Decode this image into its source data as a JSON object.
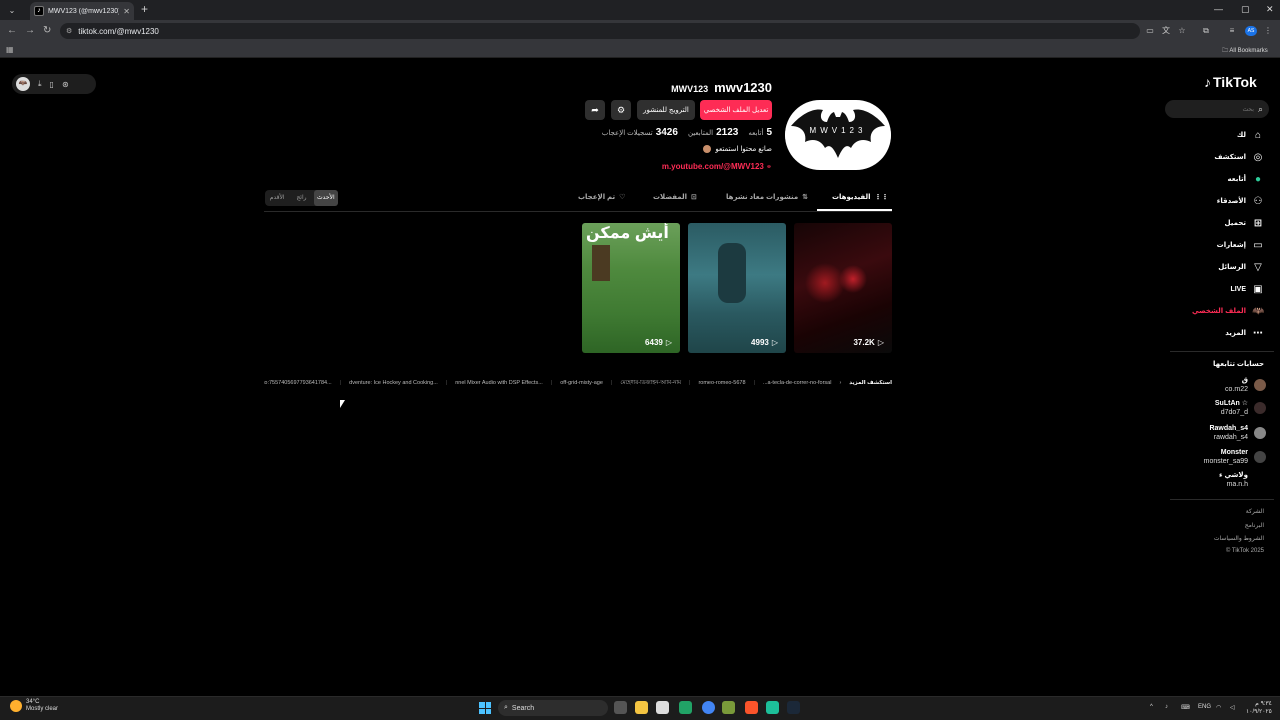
{
  "browser": {
    "tab_title": "MWV123 (@mwv1230) | TikTok",
    "new_tab": "+",
    "url": "tiktok.com/@mwv1230",
    "all_bookmarks": "All Bookmarks",
    "profile_initials": "AS"
  },
  "extension_pill": {
    "icons": [
      "bat-icon",
      "download-icon",
      "phone-icon",
      "settings-icon"
    ]
  },
  "sidebar": {
    "logo": "TikTok",
    "search_placeholder": "بحث",
    "nav": [
      {
        "label": "لك",
        "icon": "home-icon"
      },
      {
        "label": "استكشف",
        "icon": "compass-icon"
      },
      {
        "label": "أتابعه",
        "icon": "following-icon"
      },
      {
        "label": "الأصدقاء",
        "icon": "friends-icon"
      },
      {
        "label": "تحميل",
        "icon": "upload-icon"
      },
      {
        "label": "إشعارات",
        "icon": "notifications-icon"
      },
      {
        "label": "الرسائل",
        "icon": "messages-icon"
      },
      {
        "label": "LIVE",
        "icon": "live-icon"
      },
      {
        "label": "الملف الشخصي",
        "icon": "profile-icon",
        "active": true
      },
      {
        "label": "المزيد",
        "icon": "more-icon"
      }
    ],
    "following_heading": "حسابات تتابعها",
    "following": [
      {
        "name": "ق",
        "handle": "co.m22"
      },
      {
        "name": "SuLtAn ☆",
        "handle": "d7do7_d"
      },
      {
        "name": "Rawdah_s4",
        "handle": "rawdah_s4"
      },
      {
        "name": "Monster",
        "handle": "monster_sa99"
      },
      {
        "name": "ولاشي ء",
        "handle": "ma.n.h"
      }
    ],
    "footer": [
      "الشركة",
      "البرنامج",
      "الشروط والسياسات",
      "© TikTok 2025"
    ]
  },
  "profile": {
    "username": "mwv1230",
    "display_name": "MWV123",
    "edit_button": "تعديل الملف الشخصي",
    "promote_button": "الترويج للمنشور",
    "stats": [
      {
        "value": "5",
        "label": "أتابعه"
      },
      {
        "value": "2123",
        "label": "المتابعين"
      },
      {
        "value": "3426",
        "label": "تسجيلات الإعجاب"
      }
    ],
    "bio": "صانع محتوا استمتعو",
    "link": "m.youtube.com/@MWV123"
  },
  "tabs": [
    {
      "label": "الفيديوهات",
      "icon": "grid-icon",
      "active": true
    },
    {
      "label": "منشورات معاد نشرها",
      "icon": "repost-icon"
    },
    {
      "label": "المفضلات",
      "icon": "bookmark-icon"
    },
    {
      "label": "تم الإعجاب",
      "icon": "heart-icon"
    }
  ],
  "sort": [
    "الأحدث",
    "رائج",
    "الأقدم"
  ],
  "videos": [
    {
      "views": "37.2K"
    },
    {
      "views": "4993"
    },
    {
      "views": "6439",
      "caption": "أيش ممكن"
    }
  ],
  "explore": {
    "label": "استكشف المزيد",
    "items": [
      "a-tecla-de-correr-no-forsal...",
      "romeo-romeo-5678",
      "মেহেদীর-ডিজাইন-আর্মি-নাম",
      "off-grid-misty-age",
      "...nnel Mixer Audio with DSP Effects",
      "...dventure: Ice Hockey and Cooking",
      "...ato:7557405697793641784"
    ]
  },
  "taskbar": {
    "temp": "34°C",
    "condition": "Mostly clear",
    "search": "Search",
    "lang": "ENG",
    "time": "٩:٣٤ م",
    "date": "١٠/٩/٢٠٢٥"
  }
}
